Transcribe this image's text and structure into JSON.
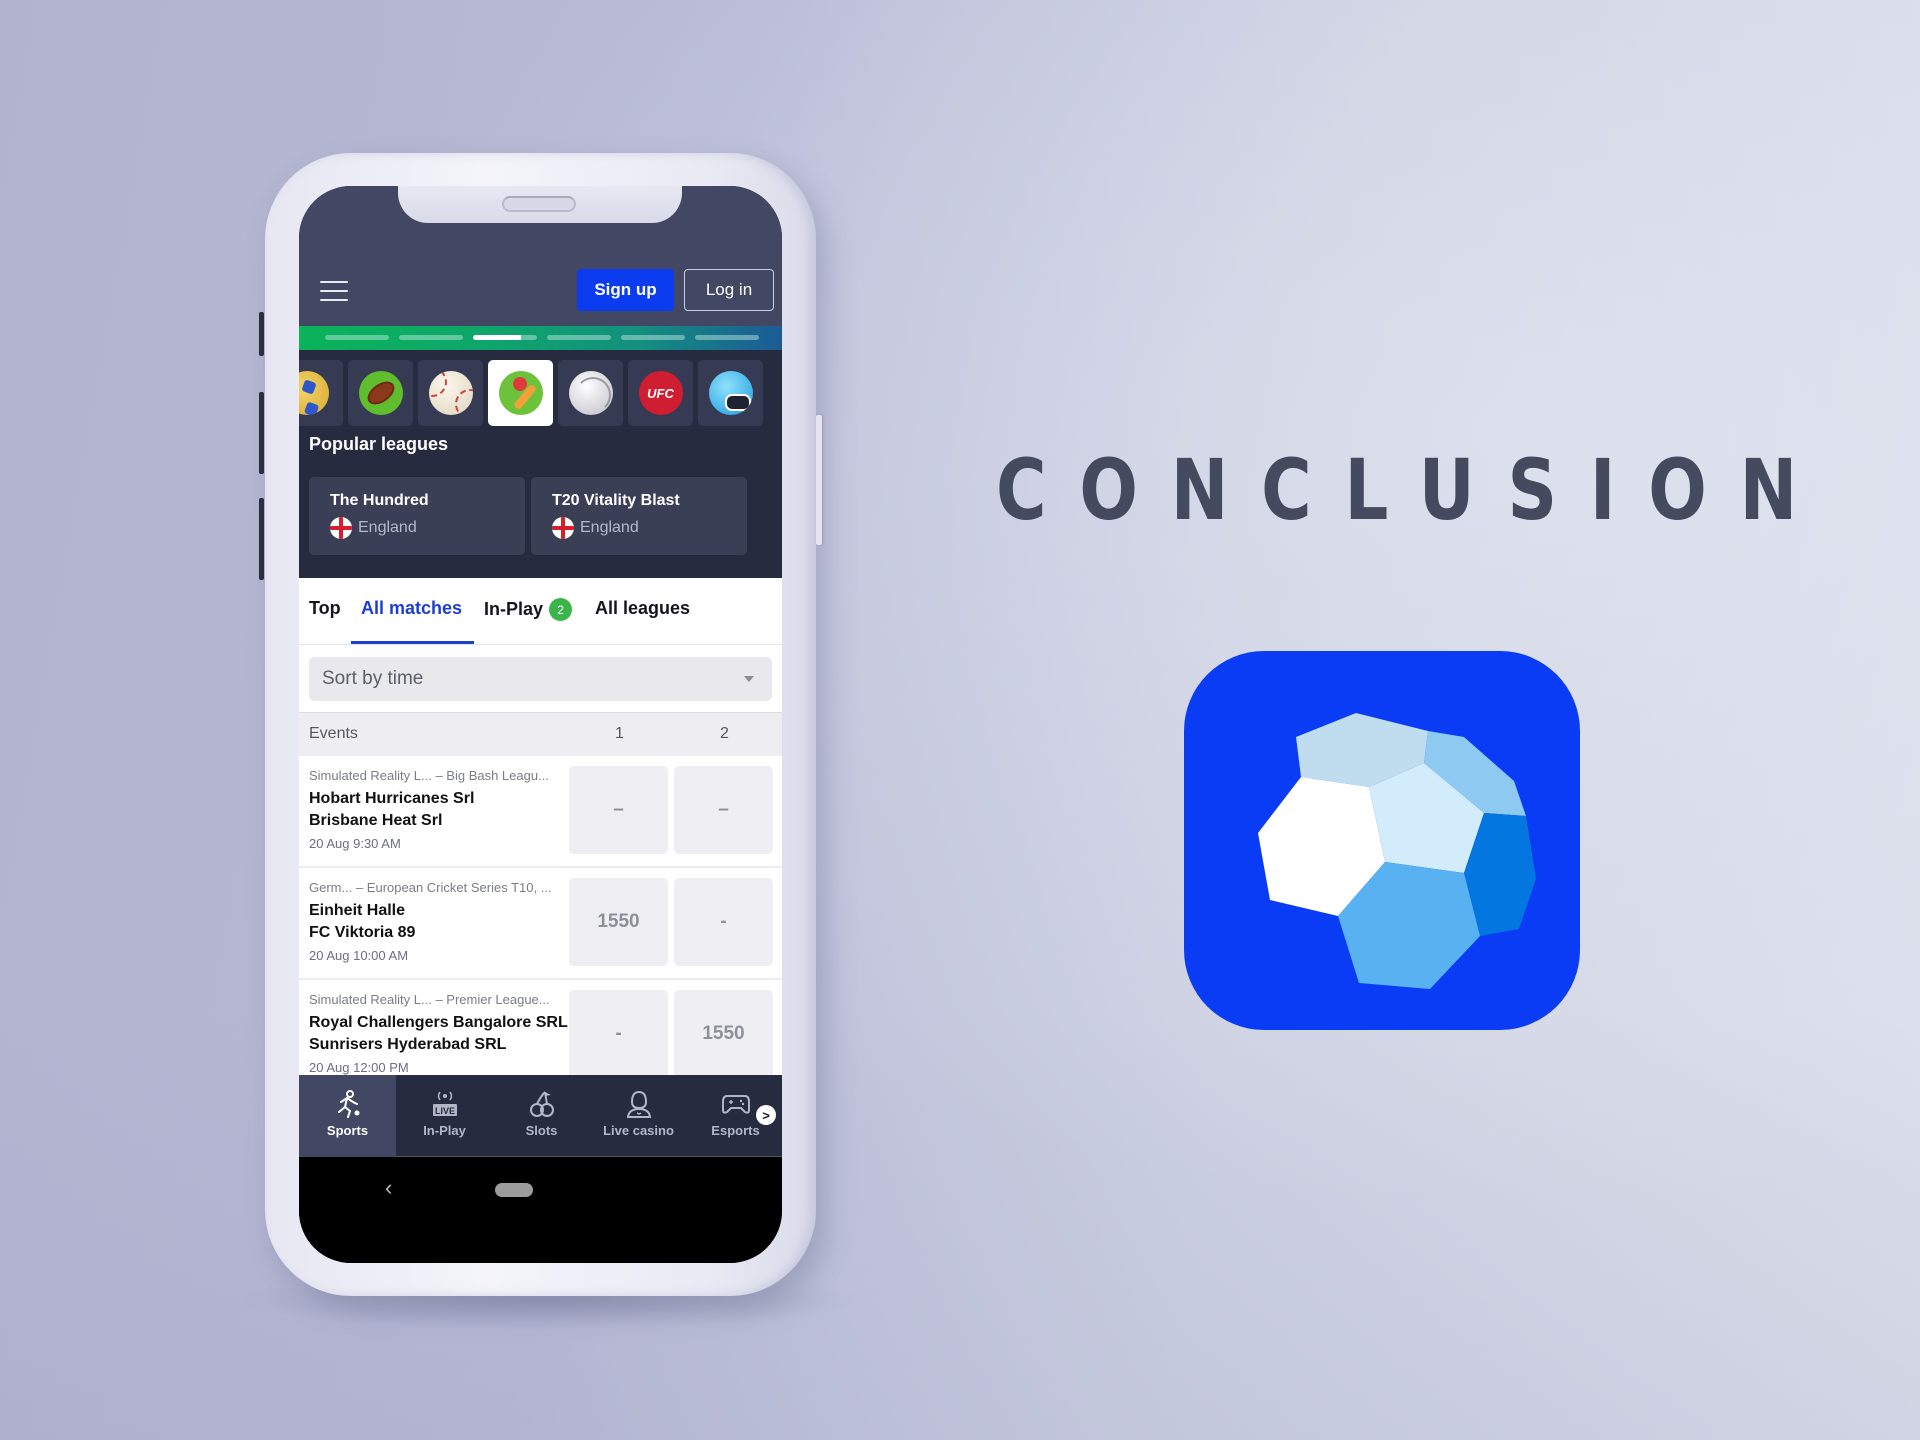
{
  "colors": {
    "brand_blue": "#0b3cf0",
    "logo_blue": "#0a3cf5",
    "header_bg": "#424864",
    "dark_bg": "#272b40",
    "active_tab": "#1d3fd0",
    "badge_green": "#39b54a",
    "heading_text": "#454a5e"
  },
  "headline": "CONCLUSION",
  "app": {
    "header": {
      "menu_icon": "hamburger-icon",
      "signup_label": "Sign up",
      "login_label": "Log in"
    },
    "banner": {
      "slide_count": 6,
      "active_slide": 3
    },
    "sports": [
      {
        "name": "Handball",
        "icon": "handball-icon",
        "active": false
      },
      {
        "name": "American Football",
        "icon": "american-football-icon",
        "active": false
      },
      {
        "name": "Baseball",
        "icon": "baseball-icon",
        "active": false
      },
      {
        "name": "Cricket",
        "icon": "cricket-icon",
        "active": true
      },
      {
        "name": "Volleyball",
        "icon": "volleyball-icon",
        "active": false
      },
      {
        "name": "UFC",
        "icon": "ufc-icon",
        "label": "UFC",
        "active": false
      },
      {
        "name": "Esports",
        "icon": "esports-icon",
        "active": false
      }
    ],
    "popular_leagues": {
      "title": "Popular leagues",
      "items": [
        {
          "name": "The Hundred",
          "country": "England",
          "flag": "england-flag-icon"
        },
        {
          "name": "T20 Vitality Blast",
          "country": "England",
          "flag": "england-flag-icon"
        }
      ]
    },
    "tabs": [
      {
        "label": "Top",
        "active": false
      },
      {
        "label": "All matches",
        "active": true
      },
      {
        "label": "In-Play",
        "badge": "2",
        "active": false
      },
      {
        "label": "All leagues",
        "active": false
      }
    ],
    "sort": {
      "selected": "Sort by time"
    },
    "events_header": {
      "label": "Events",
      "col1": "1",
      "col2": "2"
    },
    "events": [
      {
        "league": "Simulated Reality L...  – Big Bash Leagu...",
        "team1": "Hobart Hurricanes Srl",
        "team2": "Brisbane Heat Srl",
        "time": "20 Aug 9:30 AM",
        "odd1": "–",
        "odd2": "–"
      },
      {
        "league": "Germ...  – European Cricket Series T10, ...",
        "team1": "Einheit Halle",
        "team2": "FC Viktoria 89",
        "time": "20 Aug 10:00 AM",
        "odd1": "1550",
        "odd2": "-"
      },
      {
        "league": "Simulated Reality L...  – Premier League...",
        "team1": "Royal Challengers Bangalore SRL",
        "team2": "Sunrisers Hyderabad SRL",
        "time": "20 Aug 12:00 PM",
        "odd1": "-",
        "odd2": "1550"
      }
    ],
    "bottom_nav": [
      {
        "label": "Sports",
        "icon": "sports-runner-icon",
        "active": true
      },
      {
        "label": "In-Play",
        "icon": "live-icon",
        "icon_text": "LIVE",
        "active": false
      },
      {
        "label": "Slots",
        "icon": "cherries-icon",
        "active": false
      },
      {
        "label": "Live casino",
        "icon": "dealer-icon",
        "active": false
      },
      {
        "label": "Esports",
        "icon": "gamepad-icon",
        "active": false
      }
    ],
    "more_icon": ">",
    "system_nav": {
      "back_glyph": "‹"
    }
  }
}
